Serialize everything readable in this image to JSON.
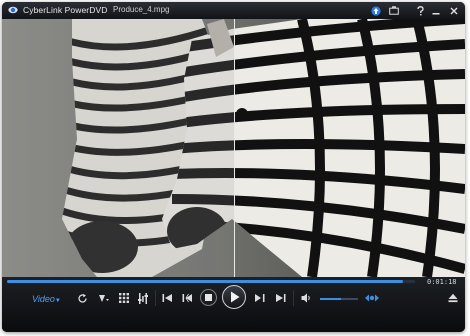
{
  "titlebar": {
    "app_title": "CyberLink PowerDVD",
    "file_name": "Produce_4.mpg",
    "icons": [
      "cyberlink-logo-icon",
      "upgrade-icon",
      "display-mode-icon",
      "help-icon",
      "minimize-icon",
      "close-icon"
    ]
  },
  "controls": {
    "mode_label": "Video",
    "seek_progress": 0.97,
    "time": "0:01:18",
    "volume_level": 0.55,
    "icons": [
      "repeat-icon",
      "settings-icon",
      "menu-grid-icon",
      "adjust-icon",
      "previous-chapter-icon",
      "step-back-icon",
      "stop-icon",
      "play-icon",
      "step-forward-icon",
      "next-chapter-icon",
      "speaker-icon",
      "eject-icon"
    ]
  },
  "colors": {
    "accent": "#3c8fe0",
    "mode_label": "#4aa3ff",
    "background": "#0c0d10"
  }
}
